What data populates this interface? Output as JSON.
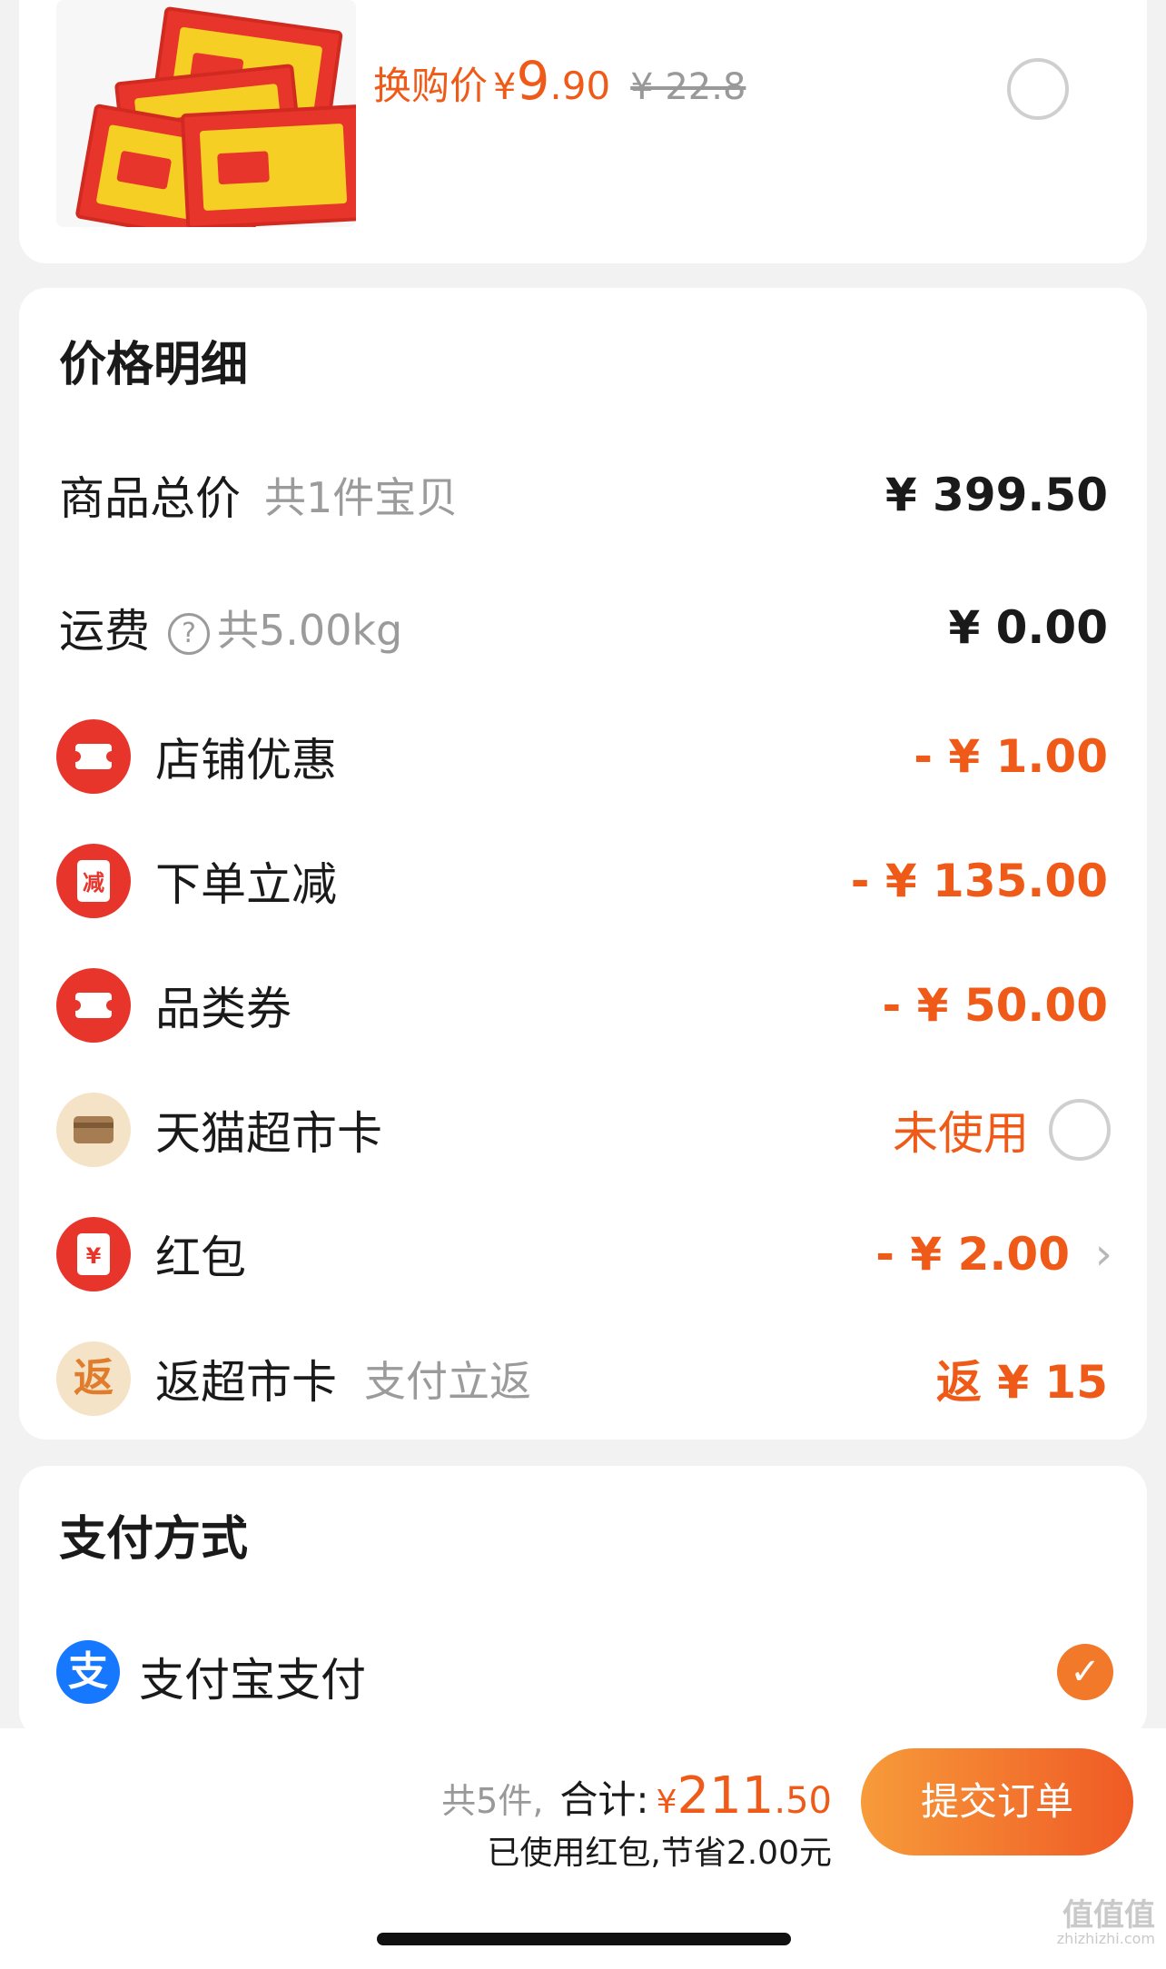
{
  "product": {
    "swap_label": "换购价",
    "currency": "¥",
    "price_int": "9",
    "price_dec": ".90",
    "original_price": "¥ 22.8"
  },
  "price_detail": {
    "title": "价格明细",
    "subtotal": {
      "label": "商品总价",
      "sub": "共1件宝贝",
      "amount": "¥ 399.50"
    },
    "shipping": {
      "label": "运费",
      "help_icon": "?",
      "sub": "共5.00kg",
      "amount": "¥ 0.00"
    },
    "shop_discount": {
      "label": "店铺优惠",
      "amount": "- ¥ 1.00"
    },
    "instant_discount": {
      "label": "下单立减",
      "icon_text": "减",
      "amount": "- ¥ 135.00"
    },
    "category_coupon": {
      "label": "品类券",
      "amount": "- ¥ 50.00"
    },
    "tmall_card": {
      "label": "天猫超市卡",
      "status": "未使用"
    },
    "red_packet": {
      "label": "红包",
      "icon_text": "¥",
      "amount": "- ¥ 2.00",
      "chevron": "›"
    },
    "cashback_card": {
      "label": "返超市卡",
      "icon_text": "返",
      "sub": "支付立返",
      "amount": "返 ¥ 15"
    }
  },
  "payment": {
    "title": "支付方式",
    "method_label": "支付宝支付",
    "method_icon_text": "支",
    "check": "✓"
  },
  "summary": {
    "count": "共5件,",
    "total_label": "合计:",
    "currency": "¥",
    "total_int": "211",
    "total_dec": ".50",
    "saving_note": "已使用红包,节省2.00元",
    "submit_label": "提交订单"
  },
  "watermark": {
    "text": "值值值",
    "sub": "zhizhizhi.com"
  },
  "colors": {
    "accent": "#f05a18",
    "button_start": "#f79b3a",
    "button_end": "#ef5a25",
    "icon_red": "#e8352c"
  }
}
